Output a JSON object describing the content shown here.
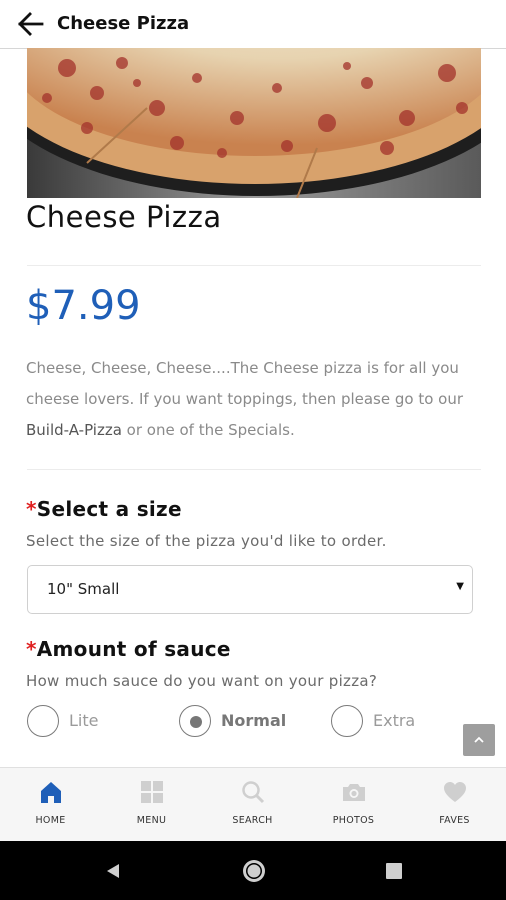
{
  "header": {
    "title": "Cheese Pizza"
  },
  "item": {
    "name": "Cheese Pizza",
    "price": "$7.99",
    "description_before_link": "Cheese, Cheese, Cheese....The Cheese pizza is for all you cheese lovers. If you want toppings, then please go to our ",
    "description_link": "Build-A-Pizza",
    "description_after_link": " or one of the Specials."
  },
  "size": {
    "required_marker": "*",
    "title": "Select a size",
    "subtitle": "Select the size of the pizza you'd like to order.",
    "selected": "10\" Small"
  },
  "sauce": {
    "required_marker": "*",
    "title": "Amount of sauce",
    "subtitle": "How much sauce do you want on your pizza?",
    "options": [
      "Lite",
      "Normal",
      "Extra"
    ],
    "selected": "Normal"
  },
  "bottom_nav": {
    "active": "HOME",
    "active_color": "#1f5fb8",
    "items": [
      "HOME",
      "MENU",
      "SEARCH",
      "PHOTOS",
      "FAVES"
    ]
  },
  "colors": {
    "price": "#1f5fb8",
    "required": "#e02020"
  }
}
